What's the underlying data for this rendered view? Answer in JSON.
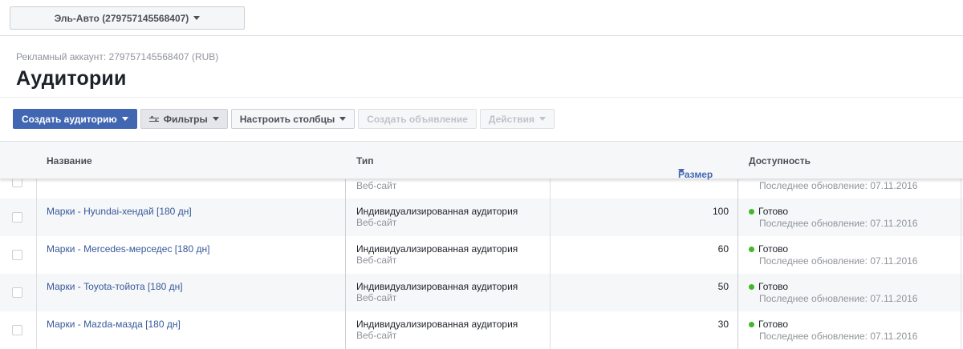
{
  "account_selector": {
    "label": "Эль-Авто (279757145568407)"
  },
  "account_line": "Рекламный аккаунт: 279757145568407 (RUB)",
  "page_title": "Аудитории",
  "toolbar": {
    "create_audience": "Создать аудиторию",
    "filters": "Фильтры",
    "columns": "Настроить столбцы",
    "create_ad": "Создать объявление",
    "actions": "Действия"
  },
  "table": {
    "headers": {
      "name": "Название",
      "type": "Тип",
      "size": "Размер",
      "availability": "Доступность"
    },
    "partial_row": {
      "type_sub": "Веб-сайт",
      "updated": "Последнее обновление: 07.11.2016"
    },
    "rows": [
      {
        "name": "Марки - Hyundai-хендай [180 дн]",
        "type": "Индивидуализированная аудитория",
        "type_sub": "Веб-сайт",
        "size": "100",
        "status": "Готово",
        "updated": "Последнее обновление: 07.11.2016"
      },
      {
        "name": "Марки - Mercedes-мерседес [180 дн]",
        "type": "Индивидуализированная аудитория",
        "type_sub": "Веб-сайт",
        "size": "60",
        "status": "Готово",
        "updated": "Последнее обновление: 07.11.2016"
      },
      {
        "name": "Марки - Toyota-тойота [180 дн]",
        "type": "Индивидуализированная аудитория",
        "type_sub": "Веб-сайт",
        "size": "50",
        "status": "Готово",
        "updated": "Последнее обновление: 07.11.2016"
      },
      {
        "name": "Марки - Mazda-мазда [180 дн]",
        "type": "Индивидуализированная аудитория",
        "type_sub": "Веб-сайт",
        "size": "30",
        "status": "Готово",
        "updated": "Последнее обновление: 07.11.2016"
      }
    ]
  },
  "colors": {
    "primary": "#4267b2",
    "link": "#365899",
    "status_ready": "#42b72a"
  }
}
